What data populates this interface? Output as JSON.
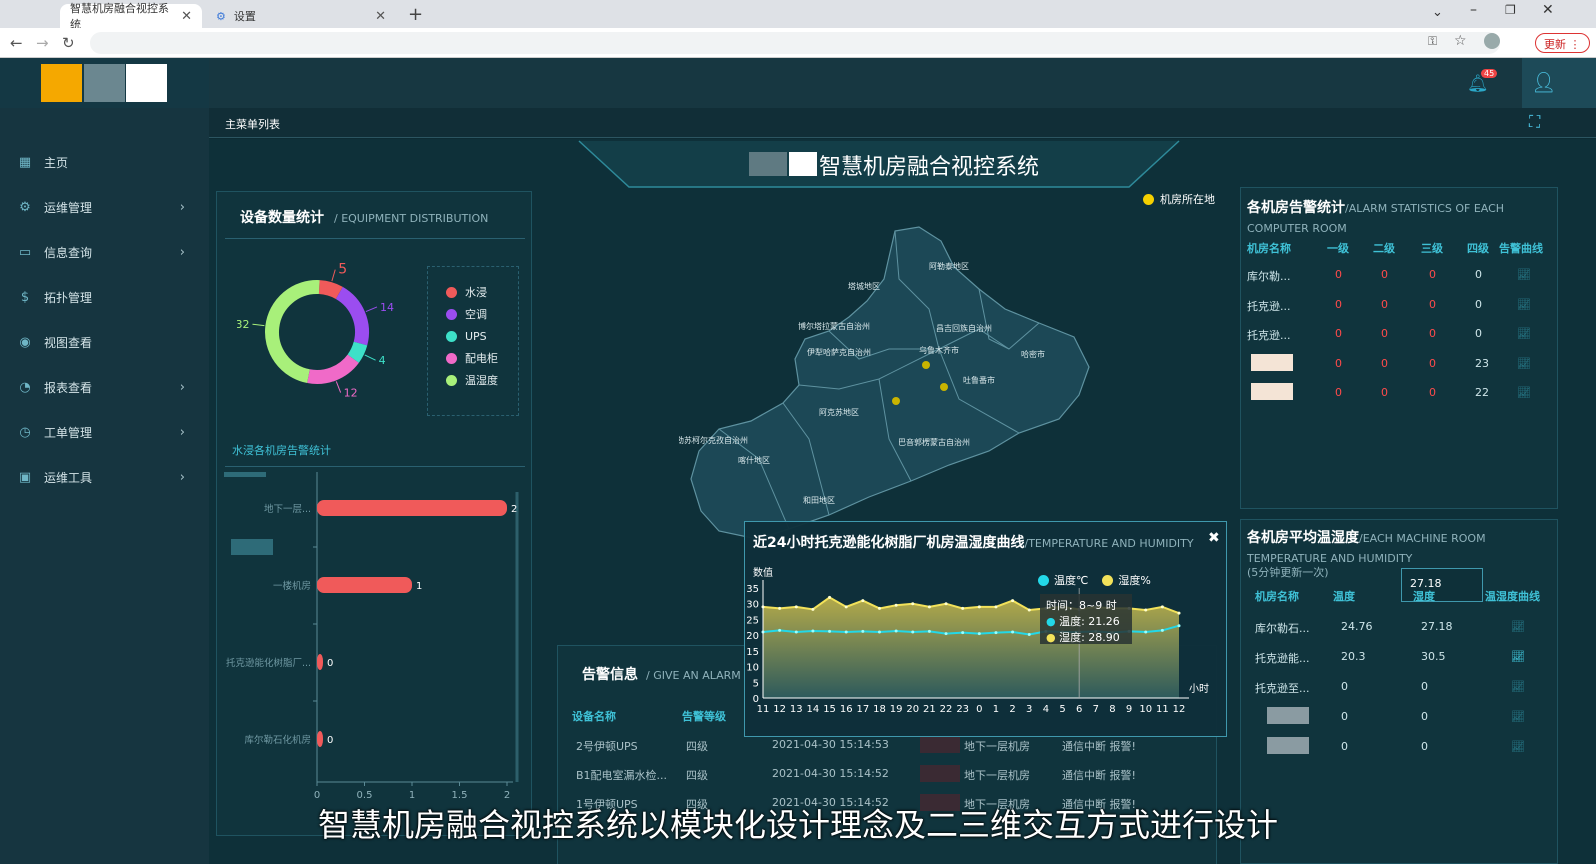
{
  "browser": {
    "tabs": [
      {
        "label": "智慧机房融合视控系统"
      },
      {
        "label": "设置"
      }
    ],
    "update_label": "更新"
  },
  "app": {
    "title": "智慧机房融合视控系统",
    "bell_count": "45",
    "crumb": "主菜单列表"
  },
  "sidebar": {
    "items": [
      {
        "label": "主页",
        "icon": "grid-icon"
      },
      {
        "label": "运维管理",
        "icon": "gear-icon"
      },
      {
        "label": "信息查询",
        "icon": "window-icon"
      },
      {
        "label": "拓扑管理",
        "icon": "dollar-icon"
      },
      {
        "label": "视图查看",
        "icon": "eye-icon"
      },
      {
        "label": "报表查看",
        "icon": "report-icon"
      },
      {
        "label": "工单管理",
        "icon": "clock-icon"
      },
      {
        "label": "运维工具",
        "icon": "briefcase-icon"
      }
    ]
  },
  "equipment": {
    "title": "设备数量统计",
    "title_en": "/ EQUIPMENT DISTRIBUTION",
    "legend": [
      {
        "name": "水浸",
        "color": "#f05a5a",
        "value": "5"
      },
      {
        "name": "空调",
        "color": "#9b4df0",
        "value": "14"
      },
      {
        "name": "UPS",
        "color": "#3de0c8",
        "value": "4"
      },
      {
        "name": "配电柜",
        "color": "#f06ac8",
        "value": "12"
      },
      {
        "name": "温湿度",
        "color": "#a8f07a",
        "value": "32"
      }
    ],
    "sub_title": "水浸各机房告警统计"
  },
  "chart_data": {
    "type": "bar",
    "orientation": "horizontal",
    "categories": [
      "地下一层...",
      "一楼机房",
      "托克逊能化树脂厂...",
      "库尔勒石化机房"
    ],
    "values": [
      2,
      1,
      0,
      0
    ],
    "xlim": [
      0,
      2
    ],
    "xticks": [
      "0",
      "0.5",
      "1",
      "1.5",
      "2"
    ]
  },
  "map": {
    "legend": "机房所在地",
    "regions": [
      "阿勒泰地区",
      "塔城地区",
      "博尔塔拉蒙古自治州",
      "昌吉回族自治州",
      "伊犁哈萨克自治州",
      "乌鲁木齐市",
      "哈密市",
      "吐鲁番市",
      "阿克苏地区",
      "巴音郭楞蒙古自治州",
      "克孜勒苏柯尔克孜自治州",
      "喀什地区",
      "和田地区"
    ]
  },
  "alarm_stats": {
    "title": "各机房告警统计",
    "title_en": "/ALARM STATISTICS OF EACH COMPUTER ROOM",
    "headers": [
      "机房名称",
      "一级",
      "二级",
      "三级",
      "四级",
      "告警曲线"
    ],
    "rows": [
      [
        "库尔勒...",
        "0",
        "0",
        "0",
        "0"
      ],
      [
        "托克逊...",
        "0",
        "0",
        "0",
        "0"
      ],
      [
        "托克逊...",
        "0",
        "0",
        "0",
        "0"
      ],
      [
        "",
        "0",
        "0",
        "0",
        "23"
      ],
      [
        "",
        "0",
        "0",
        "0",
        "22"
      ]
    ]
  },
  "avg_temp": {
    "title": "各机房平均温湿度",
    "title_en": "/EACH MACHINE ROOM TEMPERATURE AND HUMIDITY",
    "note": "(5分钟更新一次)",
    "tooltip": "27.18",
    "headers": [
      "机房名称",
      "温度",
      "湿度",
      "温湿度曲线"
    ],
    "rows": [
      [
        "库尔勒石...",
        "24.76",
        "27.18"
      ],
      [
        "托克逊能...",
        "20.3",
        "30.5"
      ],
      [
        "托克逊至...",
        "0",
        "0"
      ],
      [
        "",
        "0",
        "0"
      ],
      [
        "",
        "0",
        "0"
      ]
    ]
  },
  "alarm_info": {
    "title": "告警信息",
    "title_en": "/ GIVE AN ALARM",
    "headers": [
      "设备名称",
      "告警等级"
    ],
    "rows": [
      [
        "2号伊顿UPS",
        "四级",
        "2021-04-30 15:14:53",
        "地下一层机房",
        "通信中断 报警!"
      ],
      [
        "B1配电室漏水检...",
        "四级",
        "2021-04-30 15:14:52",
        "地下一层机房",
        "通信中断 报警!"
      ],
      [
        "1号伊顿UPS",
        "四级",
        "2021-04-30 15:14:52",
        "地下一层机房",
        "通信中断 报警!"
      ]
    ]
  },
  "popup": {
    "title": "近24小时托克逊能化树脂厂机房温湿度曲线",
    "title_en": "/TEMPERATURE AND HUMIDITY",
    "legend_temp": "温度℃",
    "legend_hum": "湿度%",
    "ylabel": "数值",
    "xlabel": "小时",
    "tooltip": {
      "time": "时间：8~9 时",
      "temp": "温度: 21.26",
      "hum": "湿度: 28.90"
    },
    "x": [
      "11",
      "12",
      "13",
      "14",
      "15",
      "16",
      "17",
      "18",
      "19",
      "20",
      "21",
      "22",
      "23",
      "0",
      "1",
      "2",
      "3",
      "4",
      "5",
      "6",
      "7",
      "8",
      "9",
      "10",
      "11",
      "12"
    ],
    "yticks": [
      "0",
      "5",
      "10",
      "15",
      "20",
      "25",
      "30",
      "35"
    ],
    "temp": [
      21,
      21.5,
      21,
      21.3,
      21.2,
      21,
      21.2,
      21,
      21.3,
      21,
      21.2,
      20.5,
      20.8,
      20.5,
      20.8,
      21,
      20.2,
      21.2,
      21,
      21,
      21.2,
      20.8,
      21.2,
      21,
      21.5,
      23
    ],
    "hum": [
      29,
      28.5,
      29,
      28.2,
      32,
      29,
      31,
      28.5,
      29.5,
      30,
      29,
      30,
      28.5,
      29,
      29,
      31,
      28,
      28.5,
      29,
      28.2,
      28.9,
      28.5,
      28.5,
      28,
      29,
      27
    ]
  },
  "subtitle": "智慧机房融合视控系统以模块化设计理念及二三维交互方式进行设计"
}
